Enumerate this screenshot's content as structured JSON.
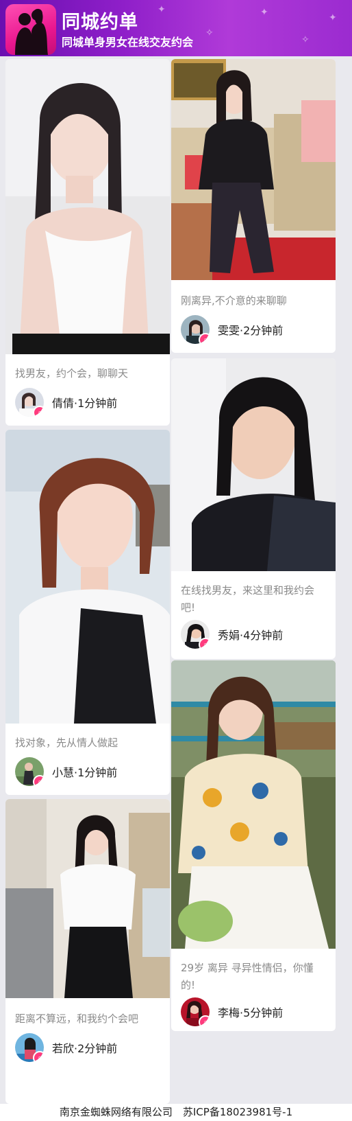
{
  "header": {
    "title": "同城约单",
    "subtitle": "同城单身男女在线交友约会"
  },
  "colors": {
    "header_gradient_start": "#6a0fb0",
    "header_gradient_end": "#b03ad8",
    "logo_pink": "#e9178f",
    "badge_pink": "#ff3c7e",
    "caption_gray": "#8a8a8a"
  },
  "icons": {
    "badge": "search-magnifier-icon"
  },
  "cards": [
    {
      "caption": "找男友，约个会，聊聊天",
      "name": "倩倩",
      "time": "1分钟前"
    },
    {
      "caption": "刚离异,不介意的来聊聊",
      "name": "雯雯",
      "time": "2分钟前"
    },
    {
      "caption": "在线找男友，来这里和我约会吧!",
      "name": "秀娟",
      "time": "4分钟前"
    },
    {
      "caption": "找对象，先从情人做起",
      "name": "小慧",
      "time": "1分钟前"
    },
    {
      "caption": "29岁 离异 寻异性情侣，你懂的!",
      "name": "李梅",
      "time": "5分钟前"
    },
    {
      "caption": "距离不算远，和我约个会吧",
      "name": "若欣",
      "time": "2分钟前"
    }
  ],
  "footer": {
    "text": "南京金蜘蛛网络有限公司　苏ICP备18023981号-1"
  }
}
